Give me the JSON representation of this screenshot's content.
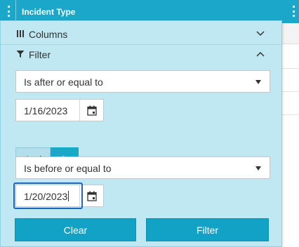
{
  "header": {
    "title": "Incident Type"
  },
  "menu": {
    "columns_label": "Columns",
    "filter_label": "Filter",
    "operator1": "Is after or equal to",
    "date1": "1/16/2023",
    "logic": {
      "and_label": "And",
      "or_label": "Or",
      "selected": "Or"
    },
    "operator2": "Is before or equal to",
    "date2": "1/20/2023",
    "clear_label": "Clear",
    "filter_button_label": "Filter"
  },
  "colors": {
    "accent": "#1ba7c9",
    "panel": "#bfe8f2",
    "focus": "#1f66c0"
  }
}
